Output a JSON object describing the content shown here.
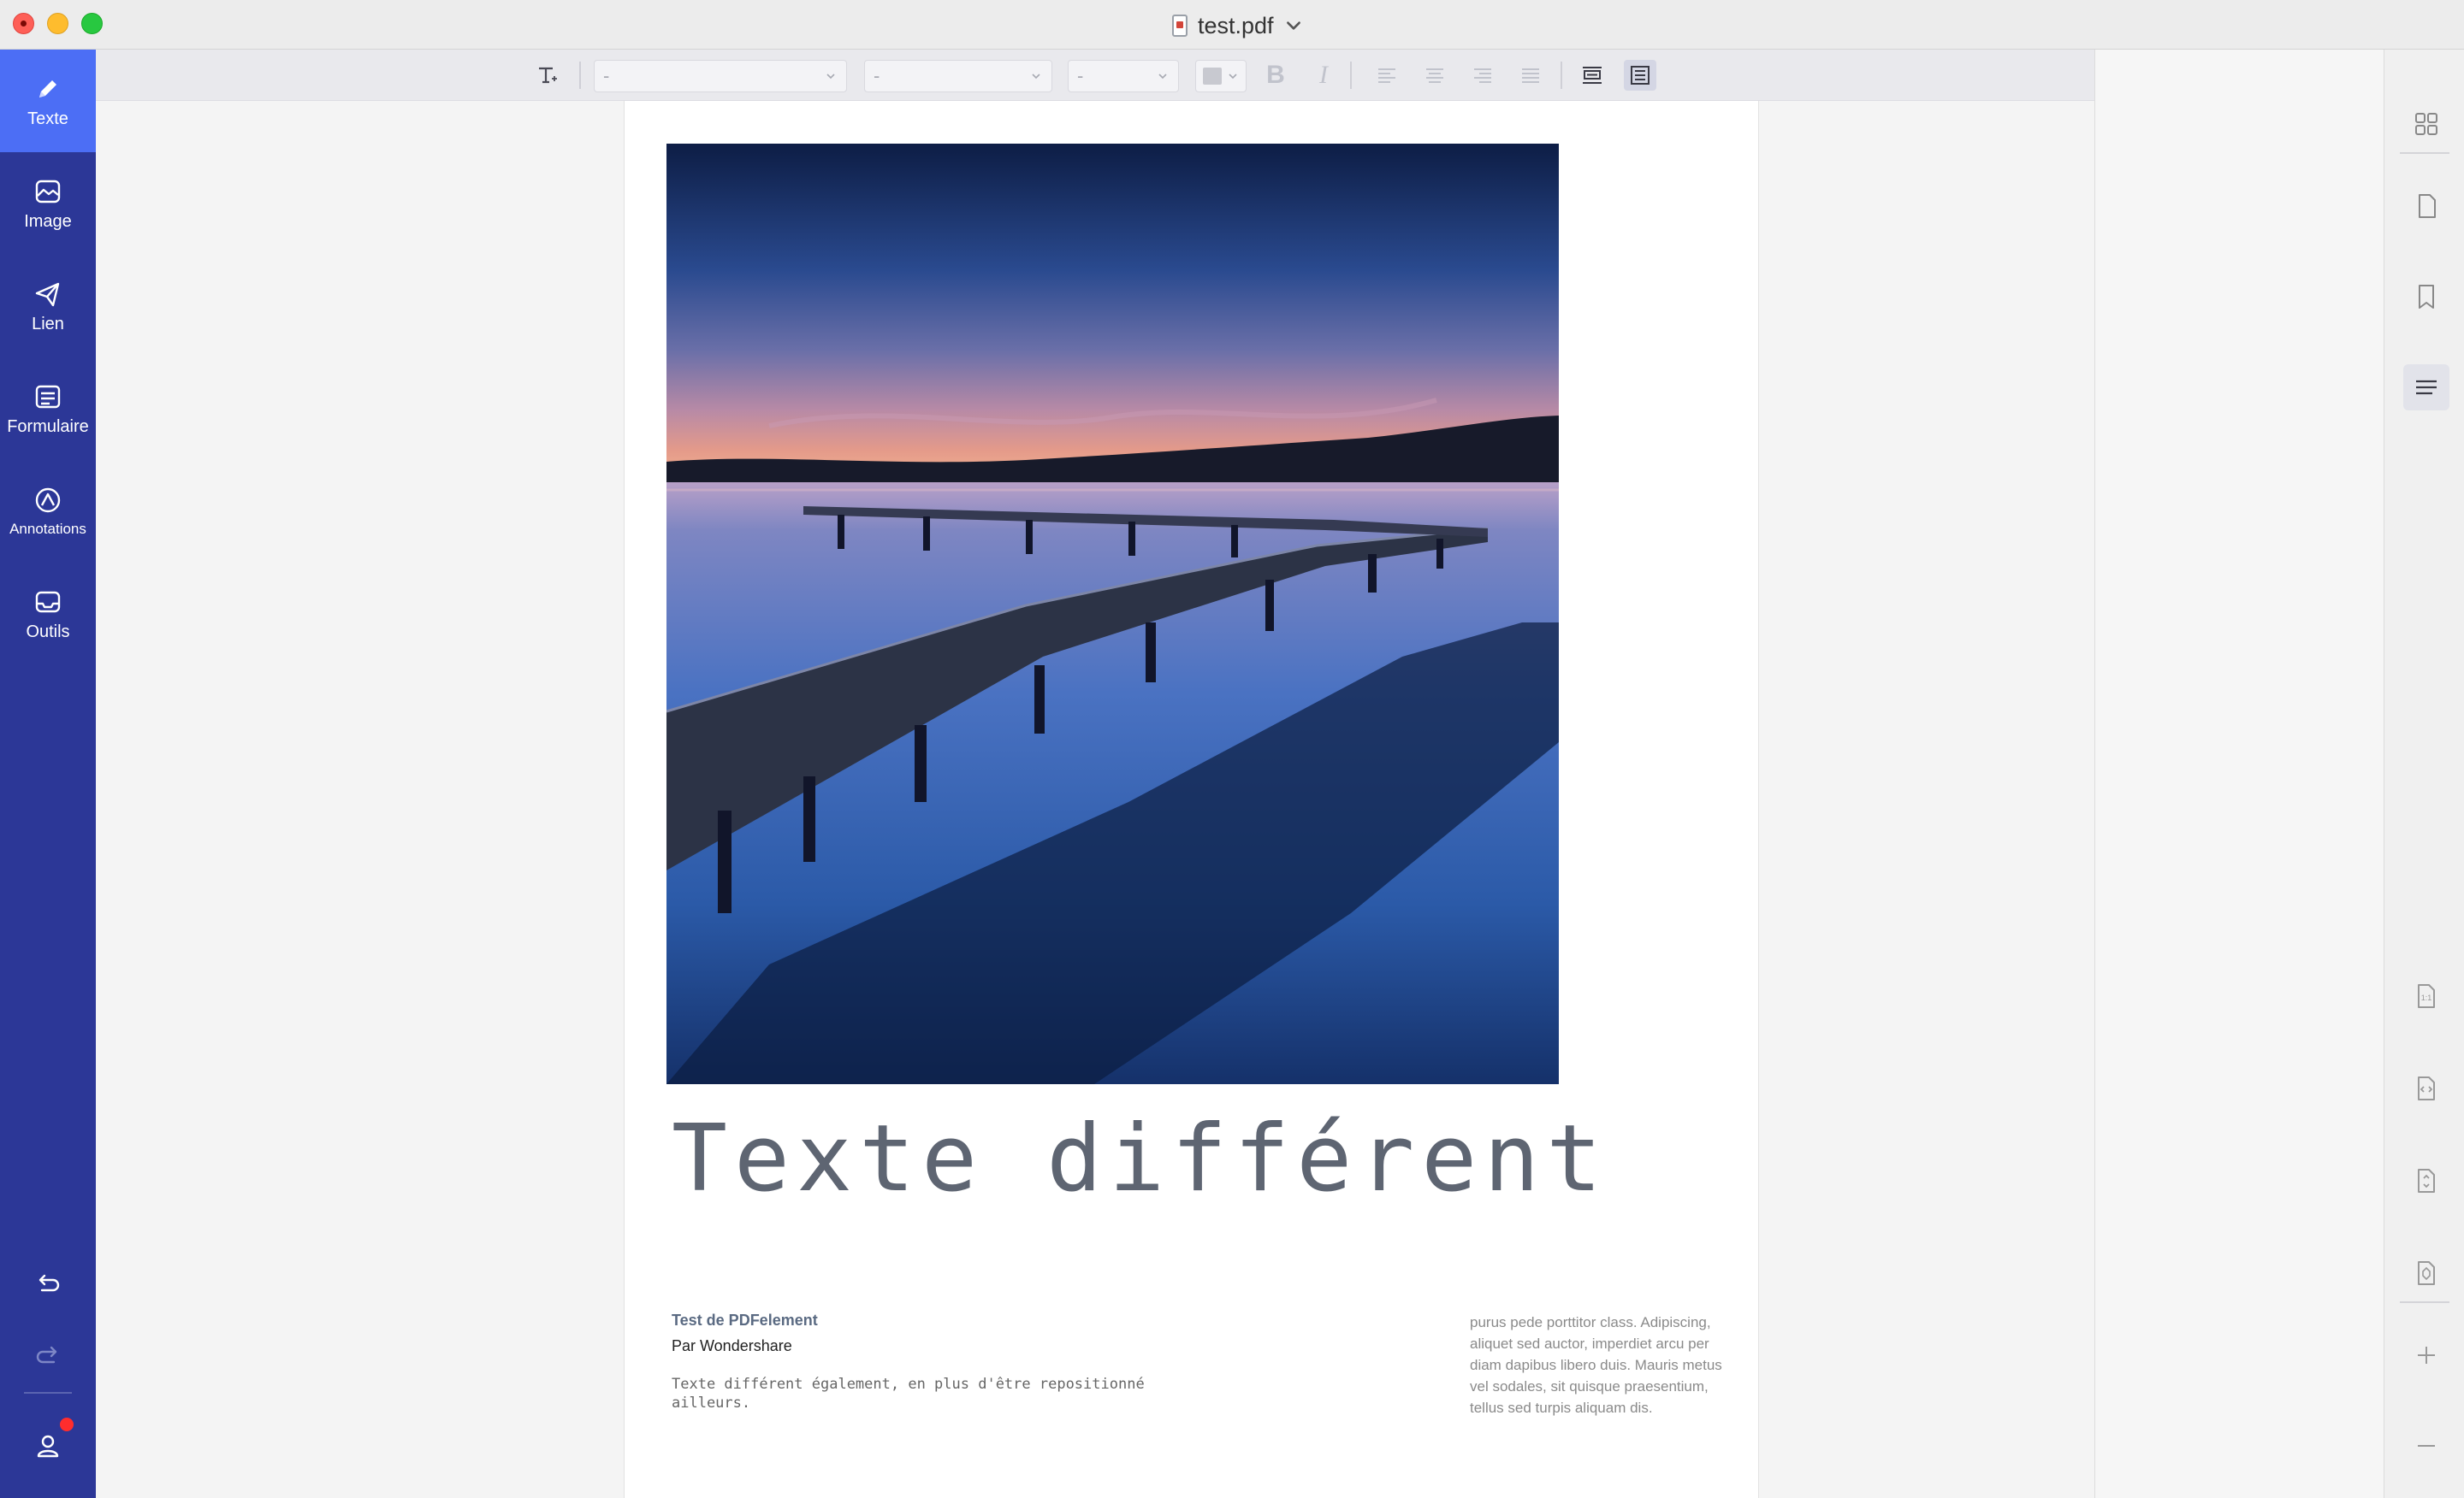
{
  "window": {
    "title": "test.pdf"
  },
  "sidebar": {
    "items": [
      {
        "label": "Texte",
        "icon": "pencil-icon",
        "active": true
      },
      {
        "label": "Image",
        "icon": "image-icon",
        "active": false
      },
      {
        "label": "Lien",
        "icon": "send-icon",
        "active": false
      },
      {
        "label": "Formulaire",
        "icon": "form-icon",
        "active": false
      },
      {
        "label": "Annotations",
        "icon": "annotation-icon",
        "active": false
      },
      {
        "label": "Outils",
        "icon": "tools-inbox-icon",
        "active": false
      }
    ],
    "bottom": [
      "undo-icon",
      "redo-icon",
      "account-icon"
    ]
  },
  "toolbar": {
    "font_family": "-",
    "font_style": "-",
    "font_size": "-",
    "buttons": [
      "text-edit-icon",
      "color-picker",
      "bold",
      "italic",
      "align-left",
      "align-center",
      "align-right",
      "align-justify",
      "text-line-mode-icon",
      "text-block-mode-icon"
    ],
    "bold_label": "B",
    "italic_label": "I"
  },
  "document": {
    "heading": "Texte différent",
    "subtitle_bold": "Test de PDFelement",
    "subtitle_author": "Par Wondershare",
    "mono_note": "Texte différent également, en plus d'être repositionné ailleurs.",
    "right_column": "purus pede porttitor class. Adipiscing, aliquet sed auctor, imperdiet arcu per diam dapibus libero duis. Mauris metus vel sodales, sit quisque praesentium, tellus sed turpis aliquam dis."
  },
  "right_panel": {
    "buttons": [
      "thumbnails-icon",
      "page-icon",
      "bookmark-icon",
      "outline-icon",
      "actual-size-icon",
      "fit-width-icon",
      "fit-height-icon",
      "fit-page-icon",
      "zoom-in-icon",
      "zoom-out-icon"
    ],
    "actual_size_label": "1:1"
  },
  "colors": {
    "sidebar": "#2c3797",
    "sidebar_active": "#4c6ef5",
    "toolbar": "#e9e9ed",
    "page": "#ffffff"
  }
}
